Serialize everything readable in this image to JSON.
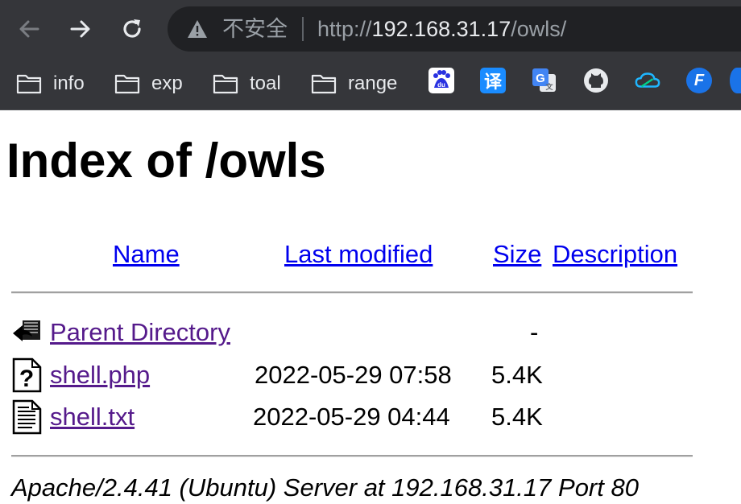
{
  "browser": {
    "insecure_label": "不安全",
    "url_scheme": "http://",
    "url_host": "192.168.31.17",
    "url_path": "/owls/",
    "bookmarks": [
      {
        "label": "info",
        "icon": "folder-icon"
      },
      {
        "label": "exp",
        "icon": "folder-icon"
      },
      {
        "label": "toal",
        "icon": "folder-icon"
      },
      {
        "label": "range",
        "icon": "folder-icon"
      }
    ],
    "extensions": [
      {
        "name": "baidu-icon",
        "glyph": "du",
        "color": "#2932e1"
      },
      {
        "name": "translate-icon",
        "glyph": "译",
        "color": "#1a8cff"
      },
      {
        "name": "google-translate-icon",
        "glyph": "G",
        "color": "#4285f4"
      },
      {
        "name": "github-icon",
        "glyph": "",
        "color": "#e8eaed"
      },
      {
        "name": "cloud-icon",
        "glyph": "",
        "color": "#1fb6ff"
      },
      {
        "name": "fetch-icon",
        "glyph": "F",
        "color": "#1a73e8"
      }
    ]
  },
  "page": {
    "title": "Index of /owls",
    "columns": {
      "name": "Name",
      "last_modified": "Last modified",
      "size": "Size",
      "description": "Description"
    },
    "parent": {
      "name": "Parent Directory",
      "size": "-",
      "icon": "back-icon"
    },
    "files": [
      {
        "name": "shell.php",
        "modified": "2022-05-29 07:58",
        "size": "5.4K",
        "icon": "unknown-file-icon"
      },
      {
        "name": "shell.txt",
        "modified": "2022-05-29 04:44",
        "size": "5.4K",
        "icon": "text-file-icon"
      }
    ],
    "footer": "Apache/2.4.41 (Ubuntu) Server at 192.168.31.17 Port 80"
  }
}
